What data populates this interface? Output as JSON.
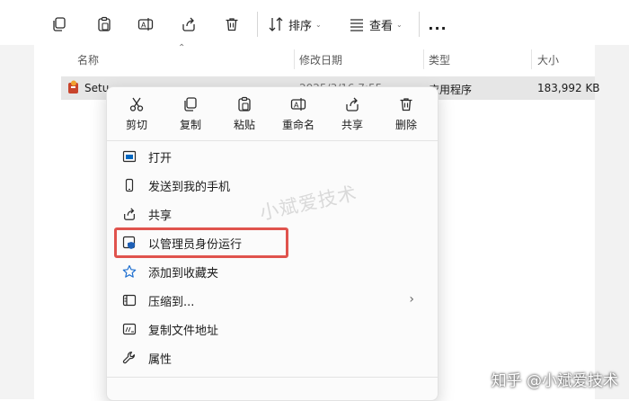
{
  "toolbar": {
    "sort_label": "排序",
    "view_label": "查看",
    "more_label": "..."
  },
  "columns": {
    "name": "名称",
    "date": "修改日期",
    "type": "类型",
    "size": "大小"
  },
  "file": {
    "name": "Setu",
    "date": "2025/3/16 7:55",
    "type": "应用程序",
    "size": "183,992 KB"
  },
  "context_menu": {
    "quick_actions": [
      {
        "label": "剪切",
        "icon": "scissors-icon"
      },
      {
        "label": "复制",
        "icon": "copy-icon"
      },
      {
        "label": "粘贴",
        "icon": "paste-icon"
      },
      {
        "label": "重命名",
        "icon": "rename-icon"
      },
      {
        "label": "共享",
        "icon": "share-icon"
      },
      {
        "label": "删除",
        "icon": "trash-icon"
      }
    ],
    "items": [
      {
        "label": "打开",
        "icon": "open-icon"
      },
      {
        "label": "发送到我的手机",
        "icon": "phone-icon"
      },
      {
        "label": "共享",
        "icon": "share-icon"
      },
      {
        "label": "以管理员身份运行",
        "icon": "shield-icon"
      },
      {
        "label": "添加到收藏夹",
        "icon": "star-icon"
      },
      {
        "label": "压缩到...",
        "icon": "zip-icon"
      },
      {
        "label": "复制文件地址",
        "icon": "path-icon"
      },
      {
        "label": "属性",
        "icon": "wrench-icon"
      }
    ]
  },
  "watermark": "小斌爱技术",
  "credit": "知乎 @小斌爱技术",
  "colors": {
    "highlight": "#e0534d",
    "accent": "#0067c0"
  }
}
